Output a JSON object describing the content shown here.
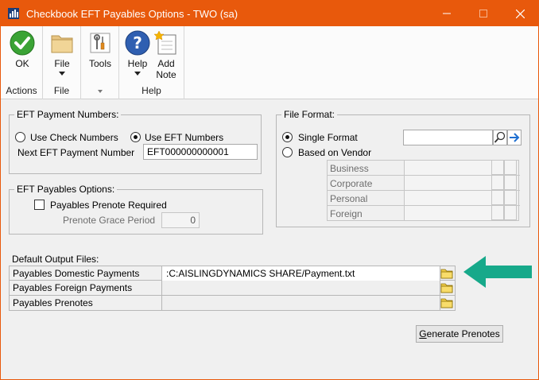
{
  "window": {
    "title": "Checkbook EFT Payables Options  -  TWO (sa)",
    "title_bar_color": "#e8590c"
  },
  "ribbon": {
    "groups": {
      "actions": {
        "label": "Actions",
        "ok_label": "OK"
      },
      "file": {
        "label": "File",
        "file_label": "File"
      },
      "tools": {
        "tools_label": "Tools"
      },
      "help": {
        "label": "Help",
        "help_label": "Help",
        "add_note_label": "Add\nNote"
      }
    }
  },
  "eft_payment_numbers": {
    "legend": "EFT Payment Numbers:",
    "use_check_numbers": "Use Check Numbers",
    "use_eft_numbers": "Use EFT Numbers",
    "selected": "Use EFT Numbers",
    "next_number_label": "Next EFT Payment Number",
    "next_number_value": "EFT000000000001"
  },
  "eft_payables_options": {
    "legend": "EFT Payables Options:",
    "prenote_required_label": "Payables Prenote Required",
    "prenote_required_checked": false,
    "grace_period_label": "Prenote Grace Period",
    "grace_period_value": "0"
  },
  "file_format": {
    "legend": "File Format:",
    "single_format": "Single Format",
    "based_on_vendor": "Based on Vendor",
    "selected": "Single Format",
    "single_format_value": "",
    "vendor_types": [
      "Business",
      "Corporate",
      "Personal",
      "Foreign"
    ]
  },
  "default_output_files": {
    "label": "Default Output Files:",
    "rows": [
      {
        "label": "Payables Domestic Payments",
        "value": ":C:AISLINGDYNAMICS SHARE/Payment.txt"
      },
      {
        "label": "Payables Foreign Payments",
        "value": ""
      },
      {
        "label": "Payables Prenotes",
        "value": ""
      }
    ]
  },
  "buttons": {
    "generate_prenotes": "Generate Prenotes",
    "generate_prenotes_hotkey": "G",
    "generate_prenotes_rest": "enerate Prenotes"
  },
  "annotation": {
    "arrow_color": "#17a98a"
  }
}
